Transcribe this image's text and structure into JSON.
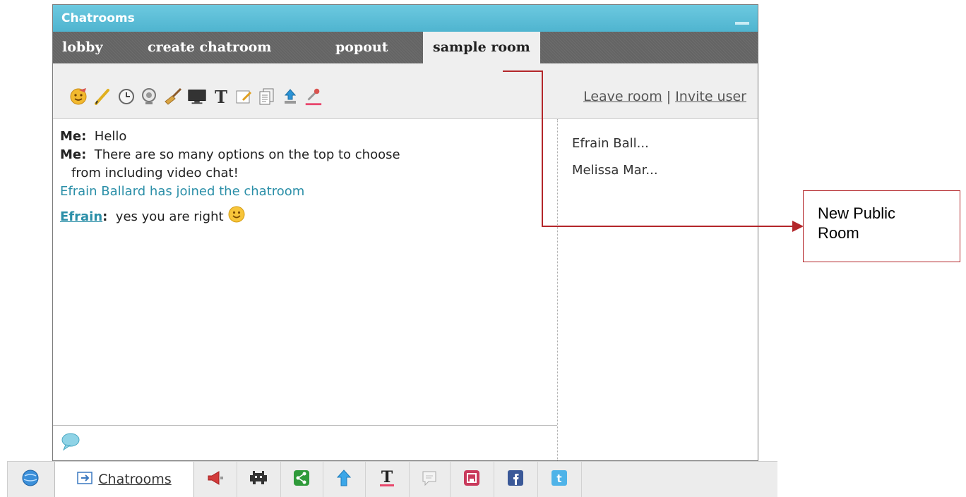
{
  "window": {
    "title": "Chatrooms"
  },
  "tabs": [
    {
      "label": "lobby"
    },
    {
      "label": "create chatroom"
    },
    {
      "label": "popout"
    },
    {
      "label": "sample room",
      "active": true
    }
  ],
  "toolbar": {
    "icons": [
      "smiley-icon",
      "pencil-icon",
      "clock-icon",
      "webcam-icon",
      "broom-icon",
      "screen-icon",
      "text-icon",
      "notepad-icon",
      "documents-icon",
      "upload-icon",
      "color-dropper-icon"
    ],
    "leave_room": "Leave room",
    "separator": "|",
    "invite_user": "Invite user"
  },
  "messages": [
    {
      "sender": "Me:",
      "text": "Hello"
    },
    {
      "sender": "Me:",
      "text": "There are so many options on the top to choose",
      "continuation": "from including video chat!"
    },
    {
      "system": "Efrain Ballard has joined the chatroom"
    },
    {
      "sender": "Efrain",
      "sender_suffix": ":",
      "text": "yes you are right"
    }
  ],
  "users": [
    "Efrain Ball...",
    "Melissa Mar..."
  ],
  "bottombar": {
    "chatrooms_label": "Chatrooms",
    "icons": [
      "globe-icon",
      "chatrooms-icon",
      "megaphone-icon",
      "games-icon",
      "share-icon",
      "arrow-up-icon",
      "text-icon",
      "chat-icon",
      "app-icon",
      "facebook-icon",
      "twitter-icon"
    ]
  },
  "annotation": {
    "line1": "New Public",
    "line2": "Room",
    "color": "#b3262a"
  },
  "colors": {
    "titlebar": "#5bbfd8",
    "tabbar": "#6b6b6b",
    "system_text": "#2b8fa8"
  }
}
